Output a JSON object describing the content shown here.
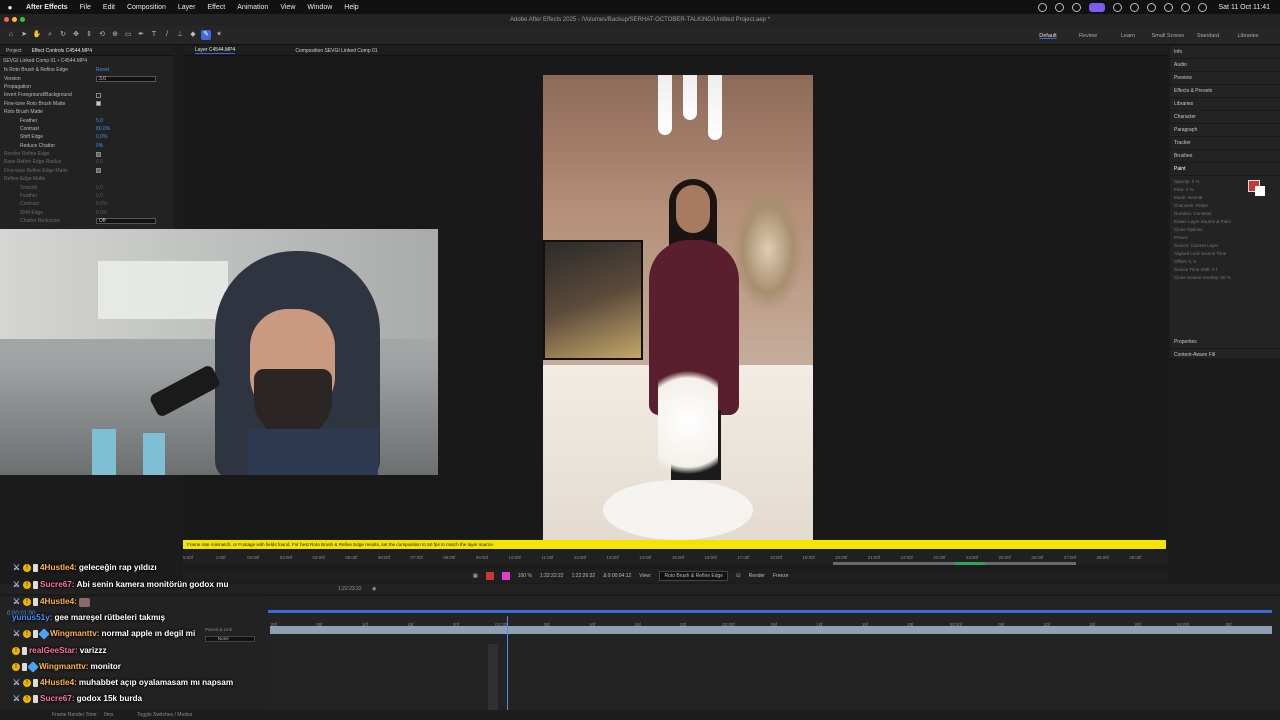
{
  "menubar": {
    "app_name": "After Effects",
    "items": [
      "File",
      "Edit",
      "Composition",
      "Layer",
      "Effect",
      "Animation",
      "View",
      "Window",
      "Help"
    ],
    "clock": "Sat 11 Oct  11:41"
  },
  "titlebar": {
    "title": "Adobe After Effects 2025 - /Volumes/Backup/SERHAT-OCTOBER-TALKING/Untitled Project.aep *"
  },
  "workspaces": [
    "Default",
    "Review",
    "Learn",
    "Small Screen",
    "Standard",
    "Libraries"
  ],
  "left_panel": {
    "tabs": [
      "Project",
      "Effect Controls C4544.MP4"
    ],
    "title": "SEVGI Linked Comp 01 • C4544.MP4",
    "rows": [
      {
        "label": "fx  Roto Brush & Refine Edge",
        "value": "Reset"
      },
      {
        "label": "Version",
        "value": "3.0"
      },
      {
        "label": "Propagation",
        "value": ""
      },
      {
        "label": "Invert Foreground/Background",
        "value": ""
      },
      {
        "label": "Fine-tune Roto Brush Matte",
        "value": ""
      },
      {
        "label": "Roto Brush Matte",
        "value": ""
      },
      {
        "label": "Feather",
        "value": "5.0"
      },
      {
        "label": "Contrast",
        "value": "80.0%"
      },
      {
        "label": "Shift Edge",
        "value": "0.0%"
      },
      {
        "label": "Reduce Chatter",
        "value": "0%"
      },
      {
        "label": "Render Refine Edge",
        "value": ""
      },
      {
        "label": "Base Refine Edge Radius",
        "value": "0.0"
      },
      {
        "label": "Fine-tune Refine Edge Matte",
        "value": ""
      },
      {
        "label": "Refine Edge Matte",
        "value": ""
      },
      {
        "label": "Smooth",
        "value": "0.0"
      },
      {
        "label": "Feather",
        "value": "0.0"
      },
      {
        "label": "Contrast",
        "value": "0.0%"
      },
      {
        "label": "Shift Edge",
        "value": "0.0%"
      },
      {
        "label": "Chatter Reduction",
        "value": "Off"
      }
    ]
  },
  "viewer": {
    "tabs": [
      "Layer C4544.MP4",
      "Composition SEVGI Linked Comp 01"
    ],
    "warning": "Frame rate mismatch, or Footage with fields found. For best Roto Brush & Refine Edge results, set the composition to 50 fps to match the layer source.",
    "ruler_ticks": [
      "5:00f",
      "5:05f",
      "1:00f",
      "01:05f",
      "02:00f",
      "02:05f",
      "03:00f",
      "03:05f",
      "04:00f",
      "04:05f",
      "05:00f",
      "05:05f",
      "06:00f",
      "06:05f",
      "07:00f",
      "07:05f",
      "08:00f",
      "08:05f",
      "09:00f",
      "09:05f",
      "10:00f",
      "10:05f",
      "11:00f",
      "11:05f",
      "12:00f",
      "12:05f",
      "13:00f",
      "13:05f",
      "14:00f",
      "14:05f",
      "15:00f",
      "15:05f",
      "16:00f",
      "16:05f",
      "17:00f",
      "17:05f",
      "18:00f",
      "18:05f",
      "19:00f",
      "19:05f",
      "20:00f",
      "20:05f",
      "21:00f",
      "21:05f",
      "22:00f",
      "22:05f",
      "23:00f",
      "23:05f",
      "24:00f",
      "24:05f",
      "25:00f",
      "25:05f",
      "26:00f",
      "26:05f",
      "27:00f",
      "27:05f",
      "28:00f",
      "28:05f",
      "29:00f",
      "29:05f"
    ],
    "controls": {
      "zoom": "100 %",
      "in_time": "1:22:22:22",
      "out_time": "1:22:26:32",
      "duration": "Δ 0:00:04:12",
      "view_label": "View:",
      "view_value": "Roto Brush & Refine Edge",
      "render_label": "Render",
      "freeze_label": "Freeze"
    },
    "swatch_colors": [
      "#c8373a",
      "#e040d0"
    ]
  },
  "right_panel": {
    "items": [
      "Info",
      "Audio",
      "Preview",
      "Effects & Presets",
      "Libraries",
      "Character",
      "Paragraph",
      "Tracker",
      "Brushes",
      "Paint"
    ],
    "paint_rows": [
      "Opacity: 0 %",
      "Flow: 0 %",
      "Mode: Normal",
      "Channels: RGBA",
      "Duration: Constant",
      "Erase: Layer Source & Paint",
      "Clone Options",
      "Preset:",
      "Source: Current Layer",
      "Aligned    Lock Source Time",
      "Offset: 0, 0",
      "Source Time Shift: 0 f",
      "Clone Source Overlay: 50 %"
    ],
    "bottom_items": [
      "Properties",
      "Content-Aware Fill"
    ],
    "paint_fg": "#c8373a",
    "paint_bg": "#ffffff"
  },
  "comp_bar": {
    "time": "1:22:23:22"
  },
  "timeline": {
    "current_time": "0:00:01:00",
    "column_header": "Parent & Link",
    "parent_value": "None",
    "ruler_ticks": [
      "00f",
      "05f",
      "10f",
      "15f",
      "20f",
      "01:00f",
      "05f",
      "10f",
      "15f",
      "20f",
      "02:00f",
      "05f",
      "10f",
      "15f",
      "20f",
      "03:00f",
      "05f",
      "10f",
      "15f",
      "20f",
      "04:00f",
      "05f"
    ],
    "footer": {
      "render_time": "Frame Render Time:",
      "render_value": "0ms",
      "toggle": "Toggle Switches / Modes"
    }
  },
  "chat": [
    {
      "user": "4Hustle4:",
      "message": "geleceğin rap yıldızı",
      "color": "#ffb347"
    },
    {
      "user": "Sucre67:",
      "message": "Abi senin kamera monitörün godox mu",
      "color": "#ff6fa0"
    },
    {
      "user": "4Hustle4:",
      "message": "",
      "color": "#ffb347"
    },
    {
      "user": "yunus51y:",
      "message": "gee mareşel rütbeleri takmış",
      "color": "#4d8ef0"
    },
    {
      "user": "Wingmanttv:",
      "message": "normal apple ın degil mi",
      "color": "#ffb347"
    },
    {
      "user": "realGeeStar:",
      "message": "varizzz",
      "color": "#ff6fa0"
    },
    {
      "user": "Wingmanttv:",
      "message": "monitor",
      "color": "#ffb347"
    },
    {
      "user": "4Hustle4:",
      "message": "muhabbet açıp oyalamasam mı napsam",
      "color": "#ffb347"
    },
    {
      "user": "Sucre67:",
      "message": "godox 15k burda",
      "color": "#ff6fa0"
    }
  ]
}
